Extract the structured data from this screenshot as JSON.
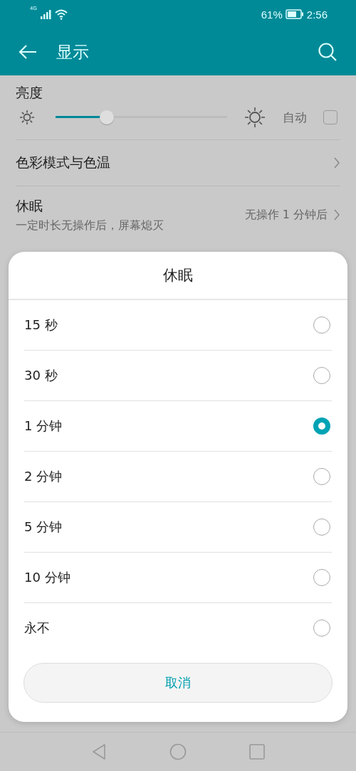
{
  "status_bar": {
    "network": "4G",
    "battery": "61%",
    "time": "2:56"
  },
  "app_bar": {
    "title": "显示"
  },
  "brightness": {
    "label": "亮度",
    "level": 0.3,
    "auto_label": "自动",
    "auto_checked": false
  },
  "settings": [
    {
      "title": "色彩模式与色温"
    },
    {
      "title": "休眠",
      "subtitle": "一定时长无操作后，屏幕熄灭",
      "value": "无操作 1 分钟后"
    }
  ],
  "dialog": {
    "title": "休眠",
    "options": [
      {
        "label": "15 秒",
        "selected": false
      },
      {
        "label": "30 秒",
        "selected": false
      },
      {
        "label": "1 分钟",
        "selected": true
      },
      {
        "label": "2 分钟",
        "selected": false
      },
      {
        "label": "5 分钟",
        "selected": false
      },
      {
        "label": "10 分钟",
        "selected": false
      },
      {
        "label": "永不",
        "selected": false
      }
    ],
    "cancel": "取消"
  }
}
